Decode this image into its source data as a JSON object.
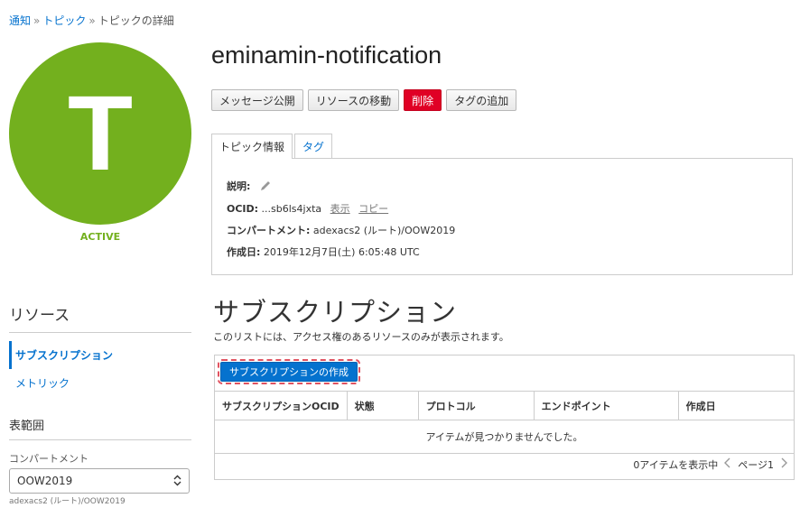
{
  "breadcrumb": {
    "items": [
      "通知",
      "トピック"
    ],
    "current": "トピックの詳細",
    "separator": "»"
  },
  "topic": {
    "avatar_letter": "T",
    "status": "ACTIVE",
    "name": "eminamin-notification"
  },
  "actions": {
    "publish": "メッセージ公開",
    "move": "リソースの移動",
    "delete": "削除",
    "add_tags": "タグの追加"
  },
  "tabs": {
    "info": "トピック情報",
    "tags": "タグ"
  },
  "info": {
    "description_label": "説明:",
    "ocid_label": "OCID:",
    "ocid_value": "...sb6ls4jxta",
    "show": "表示",
    "copy": "コピー",
    "compartment_label": "コンパートメント:",
    "compartment_value": "adexacs2 (ルート)/OOW2019",
    "created_label": "作成日:",
    "created_value": "2019年12月7日(土) 6:05:48 UTC"
  },
  "resources": {
    "title": "リソース",
    "items": [
      {
        "label": "サブスクリプション"
      },
      {
        "label": "メトリック"
      }
    ]
  },
  "scope": {
    "title": "表範囲",
    "compartment_label": "コンパートメント",
    "compartment_selected": "OOW2019",
    "compartment_help": "adexacs2 (ルート)/OOW2019"
  },
  "subscriptions": {
    "title": "サブスクリプション",
    "description": "このリストには、アクセス権のあるリソースのみが表示されます。",
    "create_button": "サブスクリプションの作成",
    "columns": [
      "サブスクリプションOCID",
      "状態",
      "プロトコル",
      "エンドポイント",
      "作成日"
    ],
    "empty_message": "アイテムが見つかりませんでした。",
    "pager_count": "0アイテムを表示中",
    "pager_page": "ページ1"
  },
  "colors": {
    "accent": "#0572ce",
    "active_green": "#73b01e",
    "danger": "#e00025"
  }
}
